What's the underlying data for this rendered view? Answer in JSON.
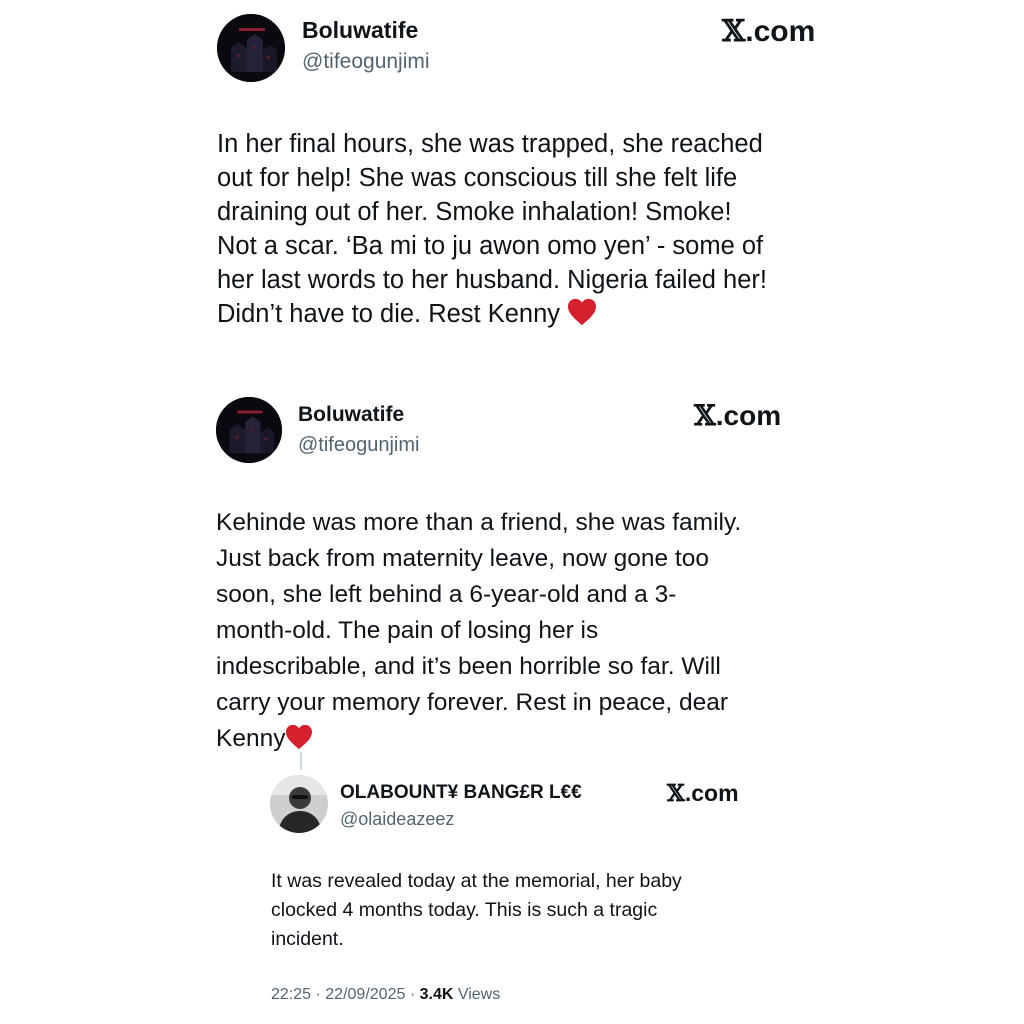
{
  "tweets": [
    {
      "author_name": "Boluwatife",
      "author_handle": "@tifeogunjimi",
      "source": ".com",
      "text": "In her final hours, she was trapped, she reached\nout for help! She was conscious till she felt life\ndraining out of her. Smoke inhalation! Smoke!\nNot a scar. ‘Ba mi to ju awon omo yen’ - some of\nher last words to her husband. Nigeria failed her!\nDidn’t have to die. Rest Kenny",
      "avatar_icon": "dark-city-avatar"
    },
    {
      "author_name": "Boluwatife",
      "author_handle": "@tifeogunjimi",
      "source": ".com",
      "text": "Kehinde was more than a friend, she was family.\nJust back from maternity leave, now gone too\nsoon, she left behind a 6-year-old and a 3-\nmonth-old. The pain of losing her is\nindescribable, and it’s been horrible so far. Will\ncarry your memory forever. Rest in peace, dear\nKenny",
      "avatar_icon": "dark-city-avatar"
    },
    {
      "author_name": "OLABOUNT¥ BANG£R L€€",
      "author_handle": "@olaideazeez",
      "source": ".com",
      "text": "It was revealed today at the memorial, her baby\nclocked 4 months today. This is such a tragic\nincident.",
      "avatar_icon": "grayscale-person-avatar"
    }
  ],
  "footer": {
    "time": "22:25",
    "separator": "·",
    "date": "22/09/2025",
    "views_count": "3.4K",
    "views_label": "Views"
  },
  "colors": {
    "text": "#0f1419",
    "secondary": "#536471",
    "heart": "#d61f2c",
    "thread_line": "#cfd9de"
  },
  "icons": [
    "x-logo-icon",
    "red-heart-icon"
  ]
}
